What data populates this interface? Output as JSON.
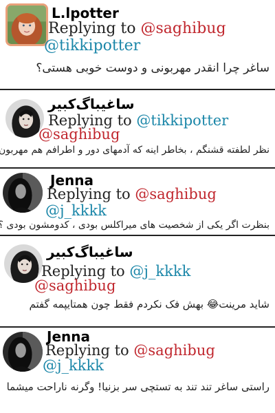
{
  "thread": [
    {
      "name": "L.lpotter",
      "reply_prefix": "Replying to",
      "handles": [
        "@saghibug",
        "@tikkipotter"
      ],
      "text": "ساغر چرا انقدر مهربونی و دوست خوبی هستی؟"
    },
    {
      "name": "ساغیباگ‌کبیر",
      "reply_prefix": "Replying to",
      "handles": [
        "@tikkipotter",
        "@saghibug"
      ],
      "text": "نظر لطفته قشنگم ، بخاطر اینه که آدمهای دور و اطرافم هم مهربون"
    },
    {
      "name": "Jenna",
      "reply_prefix": "Replying to",
      "handles": [
        "@saghibug",
        "@j_kkkk"
      ],
      "text": "بنظرت اگر یکی از شخصیت های میراکلس بودی ، کدومشون بودی ؟"
    },
    {
      "name": "ساغیباگ‌کبیر",
      "reply_prefix": "Replying to",
      "handles": [
        "@j_kkkk",
        "@saghibug"
      ],
      "text": "شاید مرینت😂 بهش فک نکردم فقط چون همتایپمه گفتم"
    },
    {
      "name": "Jenna",
      "reply_prefix": "Replying to",
      "handles": [
        "@saghibug",
        "@j_kkkk"
      ],
      "text": "راستی ساغر تند تند به تستچی سر بزنیا! وگرنه ناراحت میشما"
    }
  ],
  "colors": {
    "handle_red": "#c0262d",
    "handle_blue": "#1a86a8",
    "avatar_border": "#e9a07a"
  },
  "icons": [
    "avatar-girl-red-hair",
    "avatar-woman-dark-hair",
    "avatar-woman-dark-bw"
  ]
}
